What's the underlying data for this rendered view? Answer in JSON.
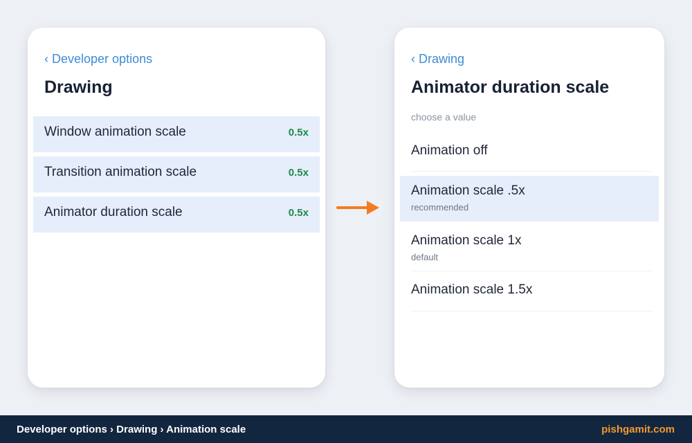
{
  "left_screen": {
    "back_label": "‹ Developer options",
    "title": "Drawing",
    "rows": [
      {
        "label": "Window animation scale",
        "value": "0.5x"
      },
      {
        "label": "Transition animation scale",
        "value": "0.5x"
      },
      {
        "label": "Animator duration scale",
        "value": "0.5x"
      }
    ]
  },
  "right_screen": {
    "back_label": "‹ Drawing",
    "title": "Animator duration scale",
    "hint": "choose a value",
    "options": [
      {
        "label": "Animation off",
        "sub": "",
        "selected": false
      },
      {
        "label": "Animation scale .5x",
        "sub": "recommended",
        "selected": true
      },
      {
        "label": "Animation scale 1x",
        "sub": "default",
        "selected": false
      },
      {
        "label": "Animation scale 1.5x",
        "sub": "",
        "selected": false
      }
    ]
  },
  "arrow": {
    "icon": "arrow-right-icon",
    "color": "#f47c20"
  },
  "footer": {
    "breadcrumb": "Developer options › Drawing › Animation scale",
    "brand": "pishgamit.com"
  },
  "colors": {
    "accent": "#3d8bd8",
    "value_green": "#1e8a4c",
    "highlight": "#e6eefb",
    "footer_bg": "#122640",
    "brand": "#f39a2c"
  }
}
